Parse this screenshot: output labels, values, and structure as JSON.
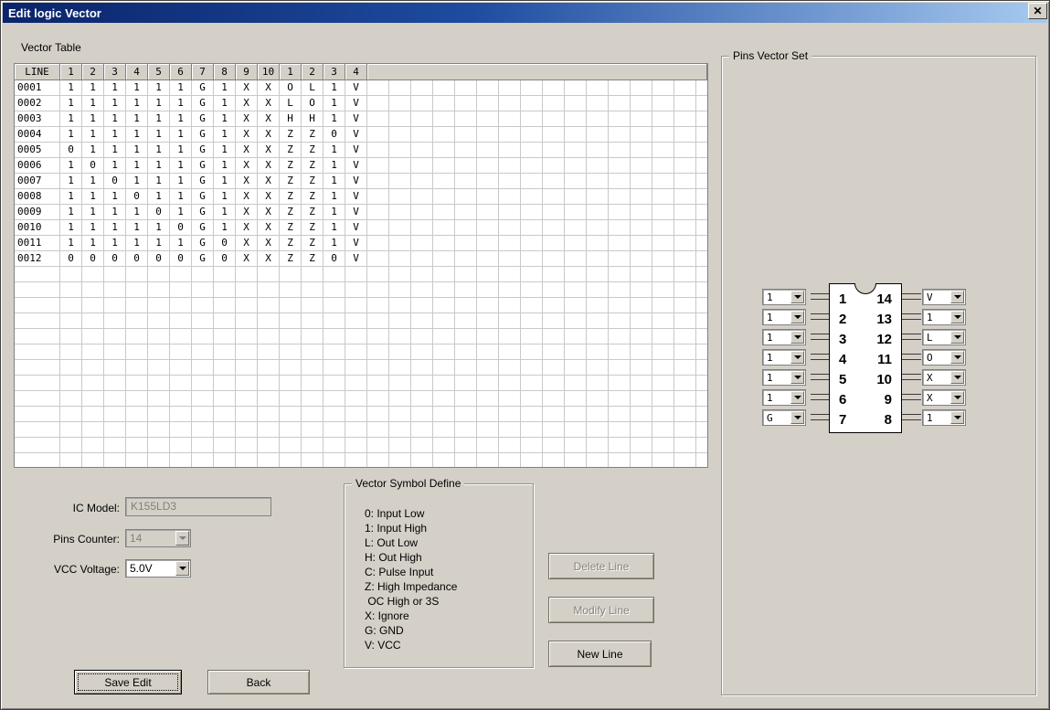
{
  "window": {
    "title": "Edit logic Vector",
    "close_icon": "✕"
  },
  "colors": {
    "dialog_face": "#d4d0c8",
    "titlebar_start": "#0a246a",
    "titlebar_end": "#a6caf0",
    "disabled_text": "#82807a"
  },
  "vector_table": {
    "section_label": "Vector Table",
    "headers": [
      "LINE",
      "1",
      "2",
      "3",
      "4",
      "5",
      "6",
      "7",
      "8",
      "9",
      "10",
      "1",
      "2",
      "3",
      "4"
    ],
    "rows": [
      {
        "line": "0001",
        "values": [
          "1",
          "1",
          "1",
          "1",
          "1",
          "1",
          "G",
          "1",
          "X",
          "X",
          "O",
          "L",
          "1",
          "V"
        ]
      },
      {
        "line": "0002",
        "values": [
          "1",
          "1",
          "1",
          "1",
          "1",
          "1",
          "G",
          "1",
          "X",
          "X",
          "L",
          "O",
          "1",
          "V"
        ]
      },
      {
        "line": "0003",
        "values": [
          "1",
          "1",
          "1",
          "1",
          "1",
          "1",
          "G",
          "1",
          "X",
          "X",
          "H",
          "H",
          "1",
          "V"
        ]
      },
      {
        "line": "0004",
        "values": [
          "1",
          "1",
          "1",
          "1",
          "1",
          "1",
          "G",
          "1",
          "X",
          "X",
          "Z",
          "Z",
          "0",
          "V"
        ]
      },
      {
        "line": "0005",
        "values": [
          "0",
          "1",
          "1",
          "1",
          "1",
          "1",
          "G",
          "1",
          "X",
          "X",
          "Z",
          "Z",
          "1",
          "V"
        ]
      },
      {
        "line": "0006",
        "values": [
          "1",
          "0",
          "1",
          "1",
          "1",
          "1",
          "G",
          "1",
          "X",
          "X",
          "Z",
          "Z",
          "1",
          "V"
        ]
      },
      {
        "line": "0007",
        "values": [
          "1",
          "1",
          "0",
          "1",
          "1",
          "1",
          "G",
          "1",
          "X",
          "X",
          "Z",
          "Z",
          "1",
          "V"
        ]
      },
      {
        "line": "0008",
        "values": [
          "1",
          "1",
          "1",
          "0",
          "1",
          "1",
          "G",
          "1",
          "X",
          "X",
          "Z",
          "Z",
          "1",
          "V"
        ]
      },
      {
        "line": "0009",
        "values": [
          "1",
          "1",
          "1",
          "1",
          "0",
          "1",
          "G",
          "1",
          "X",
          "X",
          "Z",
          "Z",
          "1",
          "V"
        ]
      },
      {
        "line": "0010",
        "values": [
          "1",
          "1",
          "1",
          "1",
          "1",
          "0",
          "G",
          "1",
          "X",
          "X",
          "Z",
          "Z",
          "1",
          "V"
        ]
      },
      {
        "line": "0011",
        "values": [
          "1",
          "1",
          "1",
          "1",
          "1",
          "1",
          "G",
          "0",
          "X",
          "X",
          "Z",
          "Z",
          "1",
          "V"
        ]
      },
      {
        "line": "0012",
        "values": [
          "0",
          "0",
          "0",
          "0",
          "0",
          "0",
          "G",
          "0",
          "X",
          "X",
          "Z",
          "Z",
          "0",
          "V"
        ]
      }
    ]
  },
  "pins_vector_set": {
    "section_label": "Pins Vector Set",
    "left_pins": [
      {
        "pin": "1",
        "value": "1"
      },
      {
        "pin": "2",
        "value": "1"
      },
      {
        "pin": "3",
        "value": "1"
      },
      {
        "pin": "4",
        "value": "1"
      },
      {
        "pin": "5",
        "value": "1"
      },
      {
        "pin": "6",
        "value": "1"
      },
      {
        "pin": "7",
        "value": "G"
      }
    ],
    "right_pins": [
      {
        "pin": "14",
        "value": "V"
      },
      {
        "pin": "13",
        "value": "1"
      },
      {
        "pin": "12",
        "value": "L"
      },
      {
        "pin": "11",
        "value": "O"
      },
      {
        "pin": "10",
        "value": "X"
      },
      {
        "pin": "9",
        "value": "X"
      },
      {
        "pin": "8",
        "value": "1"
      }
    ]
  },
  "form": {
    "ic_model": {
      "label": "IC Model:",
      "value": "K155LD3",
      "disabled": true
    },
    "pins_counter": {
      "label": "Pins Counter:",
      "value": "14",
      "disabled": true
    },
    "vcc_voltage": {
      "label": "VCC Voltage:",
      "value": "5.0V",
      "disabled": false
    }
  },
  "vector_symbol_define": {
    "section_label": "Vector Symbol Define",
    "lines": [
      "0: Input Low",
      "1: Input High",
      "L: Out Low",
      "H: Out High",
      "C: Pulse Input",
      "Z: High Impedance",
      " OC High or 3S",
      "X: Ignore",
      "G: GND",
      "V: VCC"
    ]
  },
  "buttons": {
    "delete_line": "Delete Line",
    "modify_line": "Modify Line",
    "new_line": "New Line",
    "save_edit": "Save Edit",
    "back": "Back"
  }
}
